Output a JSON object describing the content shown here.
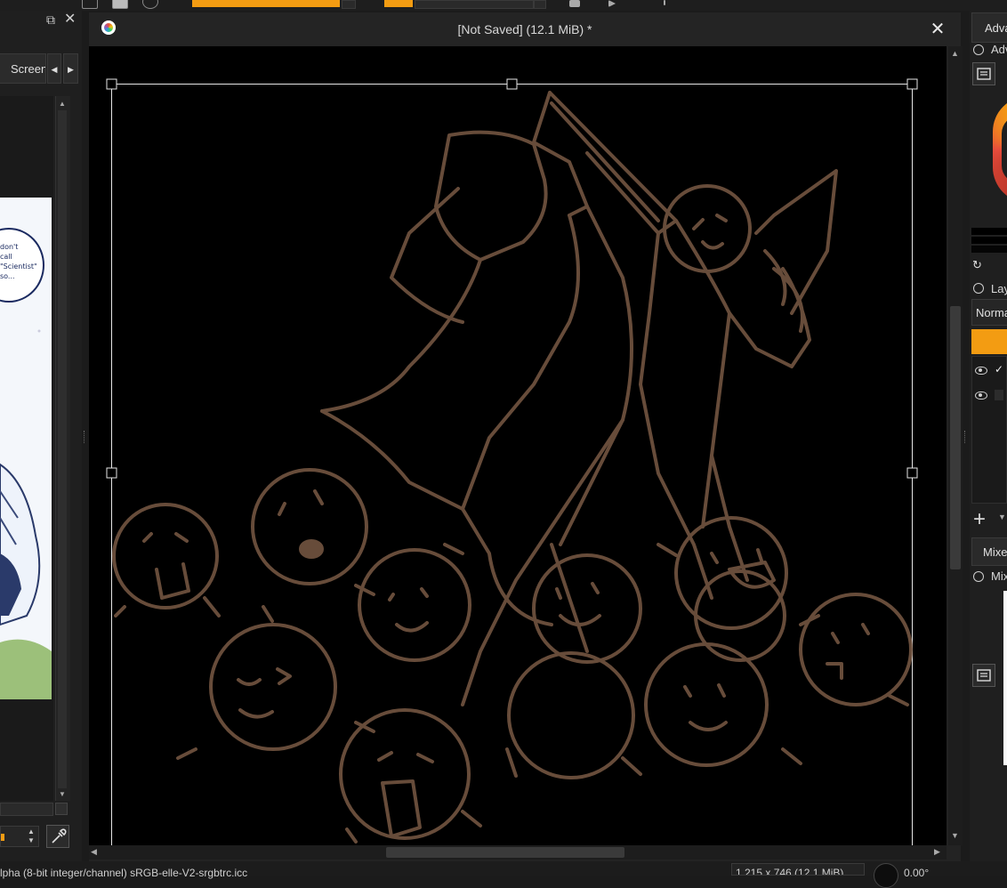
{
  "document": {
    "title": "[Not Saved]  (12.1 MiB) *"
  },
  "left_docker": {
    "tab_label": "Screen",
    "reference_bubble_text": "don't\ncall\n\"Scientist\"\nso..."
  },
  "status_bar": {
    "color_info": "lpha (8-bit integer/channel)  sRGB-elle-V2-srgbtrc.icc",
    "image_size": "1,215 x 746 (12.1 MiB)",
    "rotation": "0.00°"
  },
  "right_docker": {
    "advanced_color_tab": "Advanced Color Selector",
    "advanced_color_title": "Advanced Color Selector",
    "layers_title": "Layers",
    "blend_mode": "Normal",
    "mixer_tab": "Mixer",
    "mixer_title": "Mixer"
  },
  "icons": {
    "doc_close": "close-icon",
    "float": "float-icon",
    "left_close": "close-icon",
    "eyedropper": "eyedropper-icon",
    "refresh": "refresh-icon",
    "add_layer": "plus-icon"
  },
  "colors": {
    "accent": "#f39c12",
    "canvas": "#000000",
    "sketch_stroke": "#7a5a45"
  }
}
